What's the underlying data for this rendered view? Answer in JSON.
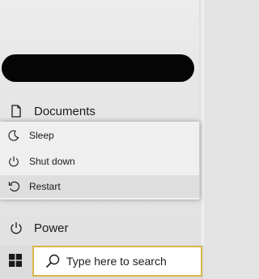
{
  "start_menu": {
    "documents": {
      "label": "Documents",
      "icon": "document-icon"
    },
    "power": {
      "label": "Power",
      "icon": "power-icon"
    }
  },
  "power_flyout": {
    "items": [
      {
        "label": "Sleep",
        "icon": "moon-icon"
      },
      {
        "label": "Shut down",
        "icon": "power-icon"
      },
      {
        "label": "Restart",
        "icon": "restart-icon",
        "highlighted": true
      }
    ]
  },
  "taskbar": {
    "start_icon": "windows-logo-icon",
    "search": {
      "placeholder": "Type here to search",
      "icon": "search-icon"
    }
  },
  "colors": {
    "search_border": "#d9b64a",
    "flyout_bg": "#efefef",
    "highlight_bg": "#dedede"
  }
}
